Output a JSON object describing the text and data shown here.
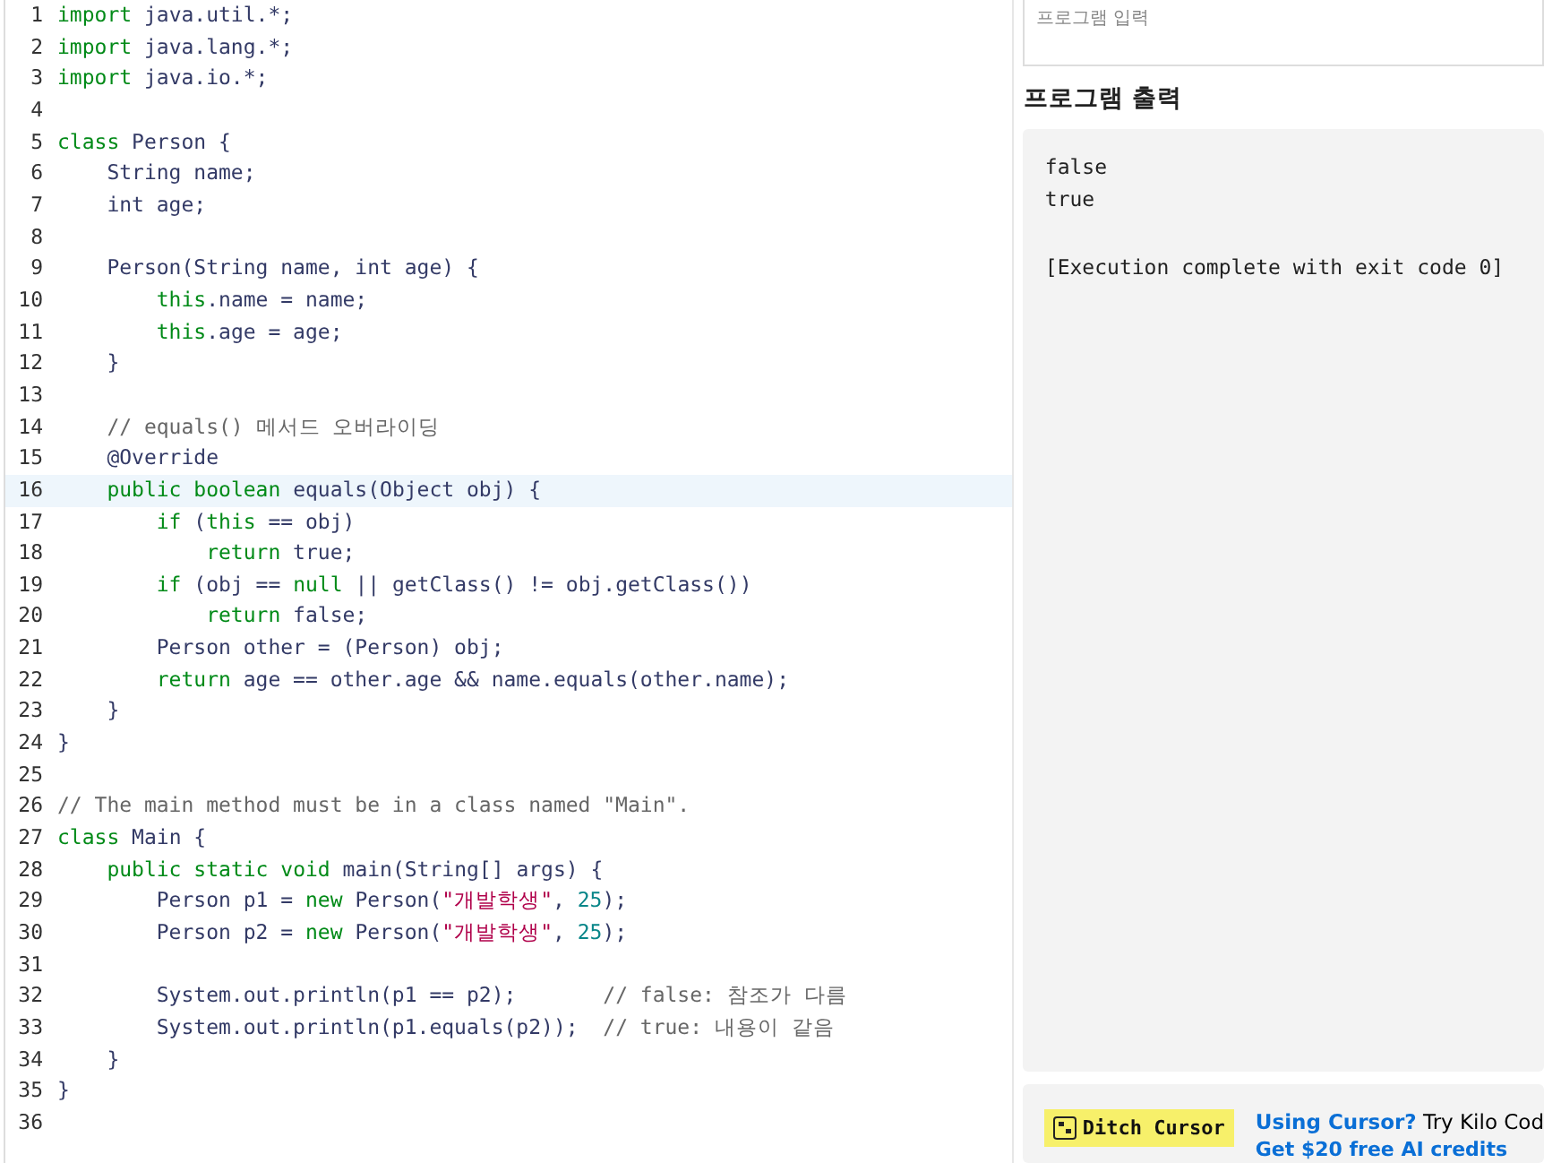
{
  "editor": {
    "lines": [
      {
        "number": "1",
        "current": false,
        "tokens": [
          {
            "text": "import",
            "kind": "keyword"
          },
          {
            "text": " java.util.*;",
            "kind": "plain"
          }
        ]
      },
      {
        "number": "2",
        "current": false,
        "tokens": [
          {
            "text": "import",
            "kind": "keyword"
          },
          {
            "text": " java.lang.*;",
            "kind": "plain"
          }
        ]
      },
      {
        "number": "3",
        "current": false,
        "tokens": [
          {
            "text": "import",
            "kind": "keyword"
          },
          {
            "text": " java.io.*;",
            "kind": "plain"
          }
        ]
      },
      {
        "number": "4",
        "current": false
      },
      {
        "number": "5",
        "current": false,
        "tokens": [
          {
            "text": "class",
            "kind": "keyword"
          },
          {
            "text": " Person {",
            "kind": "plain"
          }
        ]
      },
      {
        "number": "6",
        "current": false,
        "tokens": [
          {
            "text": "    String name;",
            "kind": "plain"
          }
        ]
      },
      {
        "number": "7",
        "current": false,
        "tokens": [
          {
            "text": "    int age;",
            "kind": "plain"
          }
        ]
      },
      {
        "number": "8",
        "current": false
      },
      {
        "number": "9",
        "current": false,
        "tokens": [
          {
            "text": "    Person(String name, int age) {",
            "kind": "plain"
          }
        ]
      },
      {
        "number": "10",
        "current": false,
        "tokens": [
          {
            "text": "        this",
            "kind": "keyword"
          },
          {
            "text": ".name = name;",
            "kind": "plain"
          }
        ]
      },
      {
        "number": "11",
        "current": false,
        "tokens": [
          {
            "text": "        this",
            "kind": "keyword"
          },
          {
            "text": ".age = age;",
            "kind": "plain"
          }
        ]
      },
      {
        "number": "12",
        "current": false,
        "tokens": [
          {
            "text": "    }",
            "kind": "plain"
          }
        ]
      },
      {
        "number": "13",
        "current": false
      },
      {
        "number": "14",
        "current": false,
        "tokens": [
          {
            "text": "    // equals() 메서드 오버라이딩",
            "kind": "comment"
          }
        ]
      },
      {
        "number": "15",
        "current": false,
        "tokens": [
          {
            "text": "    @Override",
            "kind": "plain"
          }
        ]
      },
      {
        "number": "16",
        "current": true,
        "tokens": [
          {
            "text": "    public",
            "kind": "keyword"
          },
          {
            "text": " boolean",
            "kind": "keyword"
          },
          {
            "text": " equals(Object obj) {",
            "kind": "plain"
          }
        ]
      },
      {
        "number": "17",
        "current": false,
        "tokens": [
          {
            "text": "        if",
            "kind": "keyword"
          },
          {
            "text": " (",
            "kind": "plain"
          },
          {
            "text": "this",
            "kind": "keyword"
          },
          {
            "text": " == obj)",
            "kind": "plain"
          }
        ]
      },
      {
        "number": "18",
        "current": false,
        "tokens": [
          {
            "text": "            return",
            "kind": "keyword"
          },
          {
            "text": " true;",
            "kind": "plain"
          }
        ]
      },
      {
        "number": "19",
        "current": false,
        "tokens": [
          {
            "text": "        if",
            "kind": "keyword"
          },
          {
            "text": " (obj == ",
            "kind": "plain"
          },
          {
            "text": "null",
            "kind": "keyword"
          },
          {
            "text": " || getClass() != obj.getClass())",
            "kind": "plain"
          }
        ]
      },
      {
        "number": "20",
        "current": false,
        "tokens": [
          {
            "text": "            return",
            "kind": "keyword"
          },
          {
            "text": " false;",
            "kind": "plain"
          }
        ]
      },
      {
        "number": "21",
        "current": false,
        "tokens": [
          {
            "text": "        Person other = (Person) obj;",
            "kind": "plain"
          }
        ]
      },
      {
        "number": "22",
        "current": false,
        "tokens": [
          {
            "text": "        return",
            "kind": "keyword"
          },
          {
            "text": " age == other.age && name.equals(other.name);",
            "kind": "plain"
          }
        ]
      },
      {
        "number": "23",
        "current": false,
        "tokens": [
          {
            "text": "    }",
            "kind": "plain"
          }
        ]
      },
      {
        "number": "24",
        "current": false,
        "tokens": [
          {
            "text": "}",
            "kind": "plain"
          }
        ]
      },
      {
        "number": "25",
        "current": false
      },
      {
        "number": "26",
        "current": false,
        "tokens": [
          {
            "text": "// The main method must be in a class named \"Main\".",
            "kind": "comment"
          }
        ]
      },
      {
        "number": "27",
        "current": false,
        "tokens": [
          {
            "text": "class",
            "kind": "keyword"
          },
          {
            "text": " Main {",
            "kind": "plain"
          }
        ]
      },
      {
        "number": "28",
        "current": false,
        "tokens": [
          {
            "text": "    public",
            "kind": "keyword"
          },
          {
            "text": " static",
            "kind": "keyword"
          },
          {
            "text": " void",
            "kind": "keyword"
          },
          {
            "text": " main(String[] args) {",
            "kind": "plain"
          }
        ]
      },
      {
        "number": "29",
        "current": false,
        "tokens": [
          {
            "text": "        Person p1 = ",
            "kind": "plain"
          },
          {
            "text": "new",
            "kind": "keyword"
          },
          {
            "text": " Person(",
            "kind": "plain"
          },
          {
            "text": "\"개발학생\"",
            "kind": "string"
          },
          {
            "text": ", ",
            "kind": "plain"
          },
          {
            "text": "25",
            "kind": "number"
          },
          {
            "text": ");",
            "kind": "plain"
          }
        ]
      },
      {
        "number": "30",
        "current": false,
        "tokens": [
          {
            "text": "        Person p2 = ",
            "kind": "plain"
          },
          {
            "text": "new",
            "kind": "keyword"
          },
          {
            "text": " Person(",
            "kind": "plain"
          },
          {
            "text": "\"개발학생\"",
            "kind": "string"
          },
          {
            "text": ", ",
            "kind": "plain"
          },
          {
            "text": "25",
            "kind": "number"
          },
          {
            "text": ");",
            "kind": "plain"
          }
        ]
      },
      {
        "number": "31",
        "current": false
      },
      {
        "number": "32",
        "current": false,
        "tokens": [
          {
            "text": "        System.out.println(p1 == p2);       ",
            "kind": "plain"
          },
          {
            "text": "// false: 참조가 다름",
            "kind": "comment"
          }
        ]
      },
      {
        "number": "33",
        "current": false,
        "tokens": [
          {
            "text": "        System.out.println(p1.equals(p2));  ",
            "kind": "plain"
          },
          {
            "text": "// true: 내용이 같음",
            "kind": "comment"
          }
        ]
      },
      {
        "number": "34",
        "current": false,
        "tokens": [
          {
            "text": "    }",
            "kind": "plain"
          }
        ]
      },
      {
        "number": "35",
        "current": false,
        "tokens": [
          {
            "text": "}",
            "kind": "plain"
          }
        ]
      },
      {
        "number": "36",
        "current": false
      }
    ]
  },
  "input": {
    "placeholder": "프로그램 입력"
  },
  "output": {
    "heading": "프로그램 출력",
    "groups": [
      [
        "false",
        "true"
      ],
      [
        "[Execution complete with exit code 0]"
      ]
    ]
  },
  "ad": {
    "badge": "Ditch Cursor",
    "link": "Using Cursor?",
    "text": "Try Kilo Cod",
    "link2": "Get $20 free AI credits"
  }
}
